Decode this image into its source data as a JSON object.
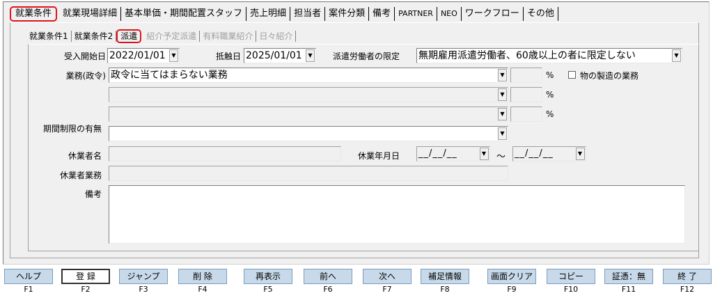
{
  "top_tabs": [
    "就業条件",
    "就業現場詳細",
    "基本単価・期間配置スタッフ",
    "売上明細",
    "担当者",
    "案件分類",
    "備考",
    "PARTNER",
    "NEO",
    "ワークフロー",
    "その他"
  ],
  "sub_tabs": [
    "就業条件1",
    "就業条件2",
    "派遣",
    "紹介予定派遣",
    "有料職業紹介",
    "日々紹介"
  ],
  "form": {
    "accept_start_label": "受入開始日",
    "accept_start_value": "2022/01/01",
    "conflict_date_label": "抵触日",
    "conflict_date_value": "2025/01/01",
    "worker_limit_label": "派遣労働者の限定",
    "worker_limit_value": "無期雇用派遣労働者、60歳以上の者に限定しない",
    "work_label": "業務(政令)",
    "work_value_1": "政令に当てはまらない業務",
    "work_value_2": "",
    "work_value_3": "",
    "percent": "%",
    "manufacturing_label": "物の製造の業務",
    "period_limit_label": "期間制限の有無",
    "period_limit_value": "",
    "leave_name_label": "休業者名",
    "leave_name_value": "",
    "leave_period_label": "休業年月日",
    "date_blank": "__/__/__",
    "tilde": "～",
    "leave_work_label": "休業者業務",
    "leave_work_value": "",
    "remarks_label": "備考",
    "remarks_value": ""
  },
  "fkeys": [
    {
      "label": "ヘルプ",
      "key": "F1"
    },
    {
      "label": "登 録",
      "key": "F2"
    },
    {
      "label": "ジャンプ",
      "key": "F3"
    },
    {
      "label": "削 除",
      "key": "F4"
    },
    {
      "label": "再表示",
      "key": "F5"
    },
    {
      "label": "前へ",
      "key": "F6"
    },
    {
      "label": "次へ",
      "key": "F7"
    },
    {
      "label": "補足情報",
      "key": "F8"
    },
    {
      "label": "画面クリア",
      "key": "F9"
    },
    {
      "label": "コピー",
      "key": "F10"
    },
    {
      "label": "証憑：無",
      "key": "F11"
    },
    {
      "label": "終 了",
      "key": "F12"
    }
  ],
  "colors": {
    "accent_red": "#e0141e",
    "fkey_bg": "#c8daea"
  }
}
